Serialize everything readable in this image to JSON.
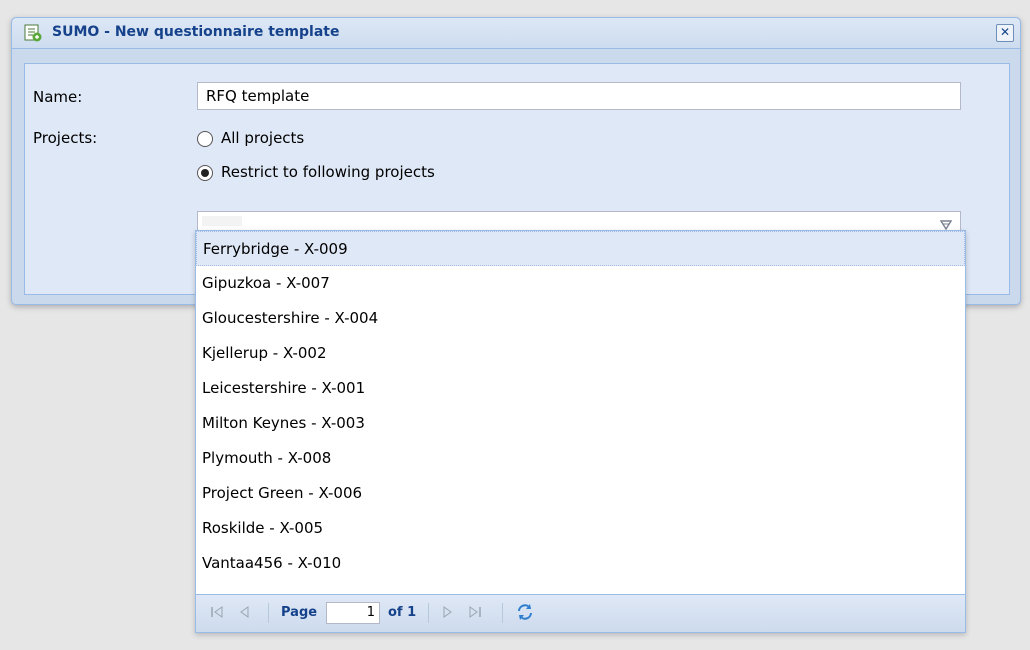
{
  "dialog": {
    "title": "SUMO - New questionnaire template",
    "close_glyph": "✕"
  },
  "form": {
    "name_label": "Name:",
    "name_value": "RFQ template",
    "projects_label": "Projects:",
    "radio_all_label": "All projects",
    "radio_restrict_label": "Restrict to following projects",
    "selected_option": "restrict"
  },
  "dropdown": {
    "items": [
      "Ferrybridge - X-009",
      "Gipuzkoa - X-007",
      "Gloucestershire - X-004",
      "Kjellerup - X-002",
      "Leicestershire - X-001",
      "Milton Keynes - X-003",
      "Plymouth - X-008",
      "Project Green - X-006",
      "Roskilde - X-005",
      "Vantaa456 - X-010"
    ],
    "highlighted_index": 0
  },
  "pager": {
    "page_label": "Page",
    "page_value": "1",
    "of_label": "of 1"
  },
  "colors": {
    "title_text": "#15428b",
    "panel_bg": "#dfe8f6",
    "border": "#99bbe8"
  },
  "icons": {
    "app": "questionnaire-app-icon",
    "close": "close-icon",
    "trigger": "dropdown-arrow-icon",
    "first": "first-page-icon",
    "prev": "prev-page-icon",
    "next": "next-page-icon",
    "last": "last-page-icon",
    "refresh": "refresh-icon"
  }
}
